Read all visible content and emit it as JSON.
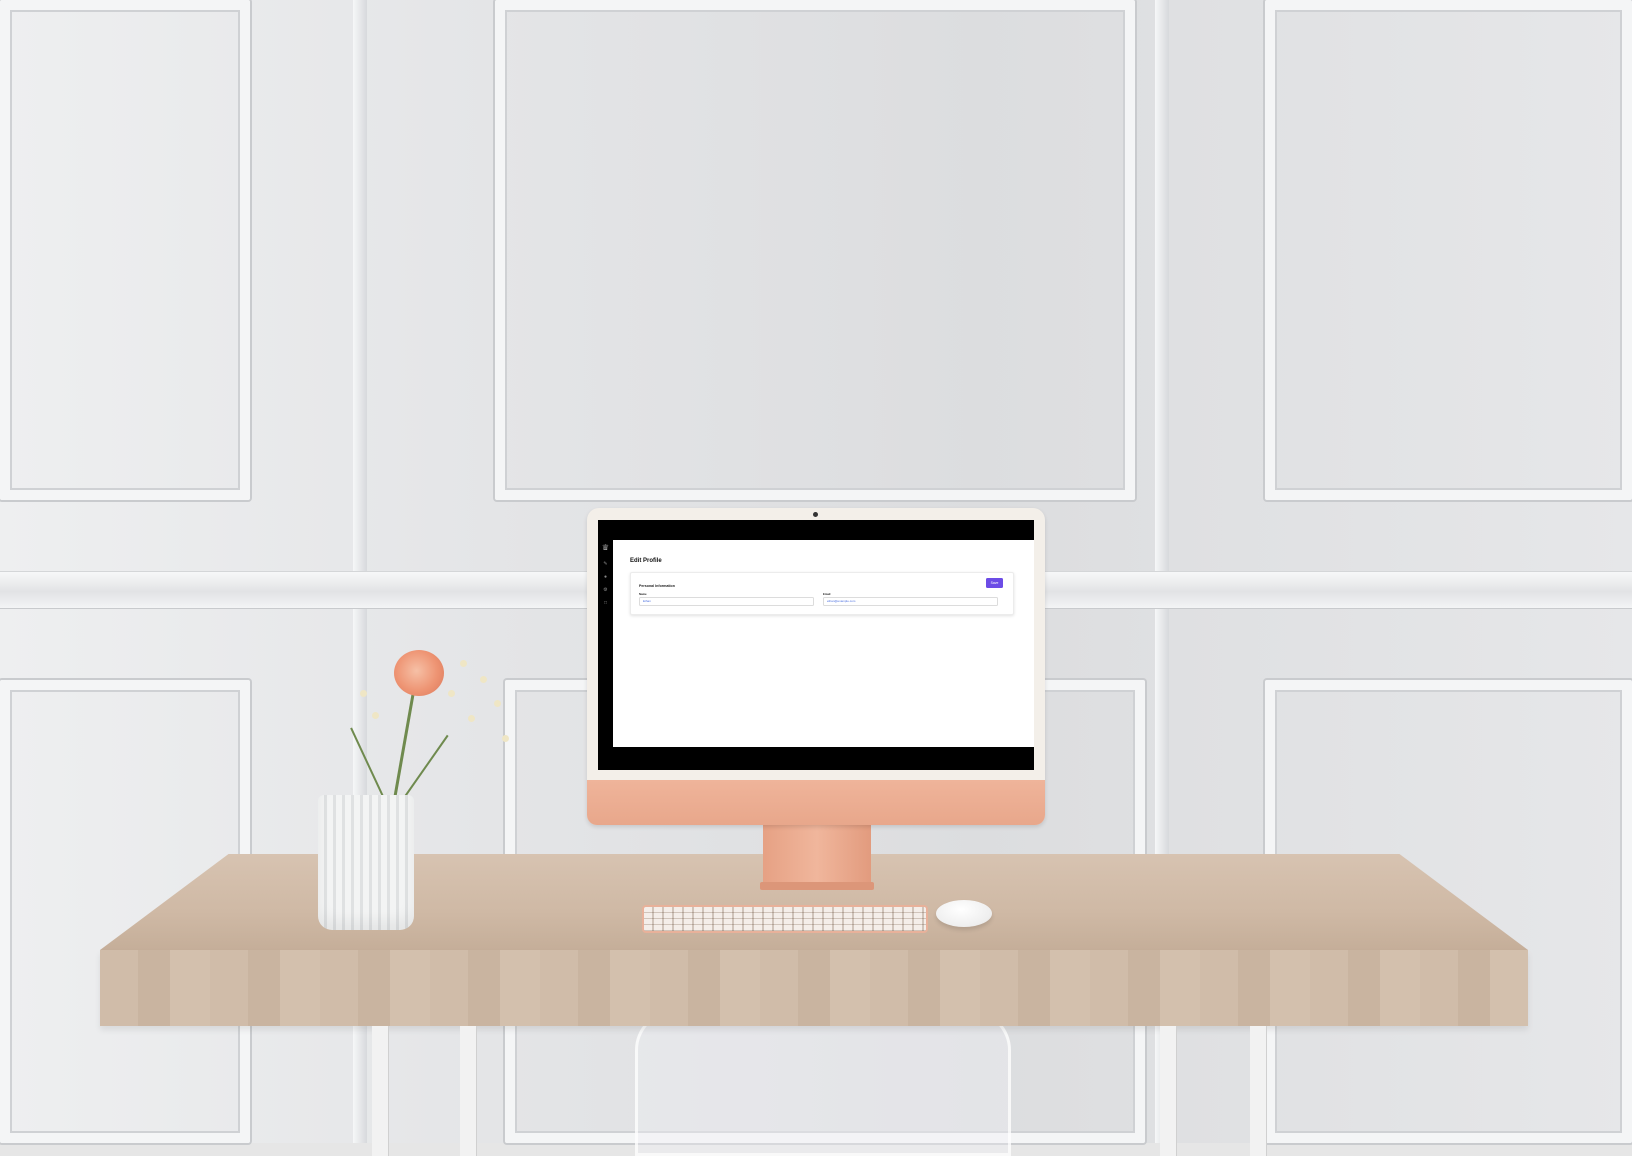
{
  "app": {
    "page_title": "Edit Profile",
    "sidebar": {
      "icons": [
        "logo-icon",
        "edit-icon",
        "user-icon",
        "settings-icon",
        "logout-icon"
      ]
    },
    "card": {
      "title": "Personal Information",
      "save_label": "Save",
      "fields": [
        {
          "label": "Name",
          "value": "Ethan"
        },
        {
          "label": "Email",
          "value": "ethan@example.com"
        }
      ]
    },
    "colors": {
      "accent": "#6c4ce6",
      "sidebar": "#000000",
      "input_text": "#4a6ee0"
    }
  }
}
